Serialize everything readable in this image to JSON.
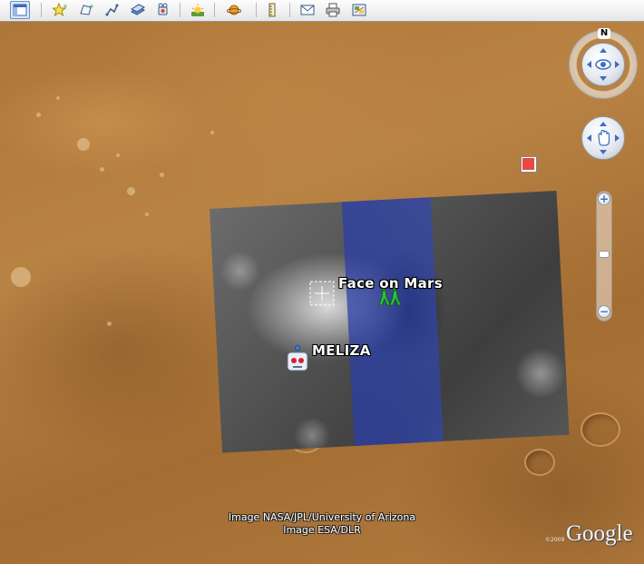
{
  "toolbar": {
    "buttons": [
      {
        "name": "show-sidebar-icon"
      },
      {
        "name": "add-placemark-icon"
      },
      {
        "name": "add-polygon-icon"
      },
      {
        "name": "add-path-icon"
      },
      {
        "name": "add-image-overlay-icon"
      },
      {
        "name": "record-tour-icon"
      },
      {
        "name": "historical-imagery-icon"
      },
      {
        "name": "sun-icon"
      },
      {
        "name": "planets-icon"
      },
      {
        "name": "ruler-icon"
      },
      {
        "name": "email-icon"
      },
      {
        "name": "print-icon"
      },
      {
        "name": "view-in-google-maps-icon"
      }
    ]
  },
  "map": {
    "places": [
      {
        "name": "face-on-mars-label",
        "text": "Face on Mars",
        "icon": "hikers-icon"
      },
      {
        "name": "meliza-label",
        "text": "MELIZA",
        "icon": "robot-icon"
      }
    ],
    "attribution": {
      "line1": "Image NASA/JPL/University of Arizona",
      "line2": "Image ESA/DLR"
    },
    "logo_text": "Google",
    "copyright_text": "©2009",
    "compass_label": "N"
  },
  "colors": {
    "terrain": "#b07a3c",
    "overlay_band": "#2d46b9",
    "label_text": "#ffffff",
    "overlay_close": "#e8483f"
  }
}
